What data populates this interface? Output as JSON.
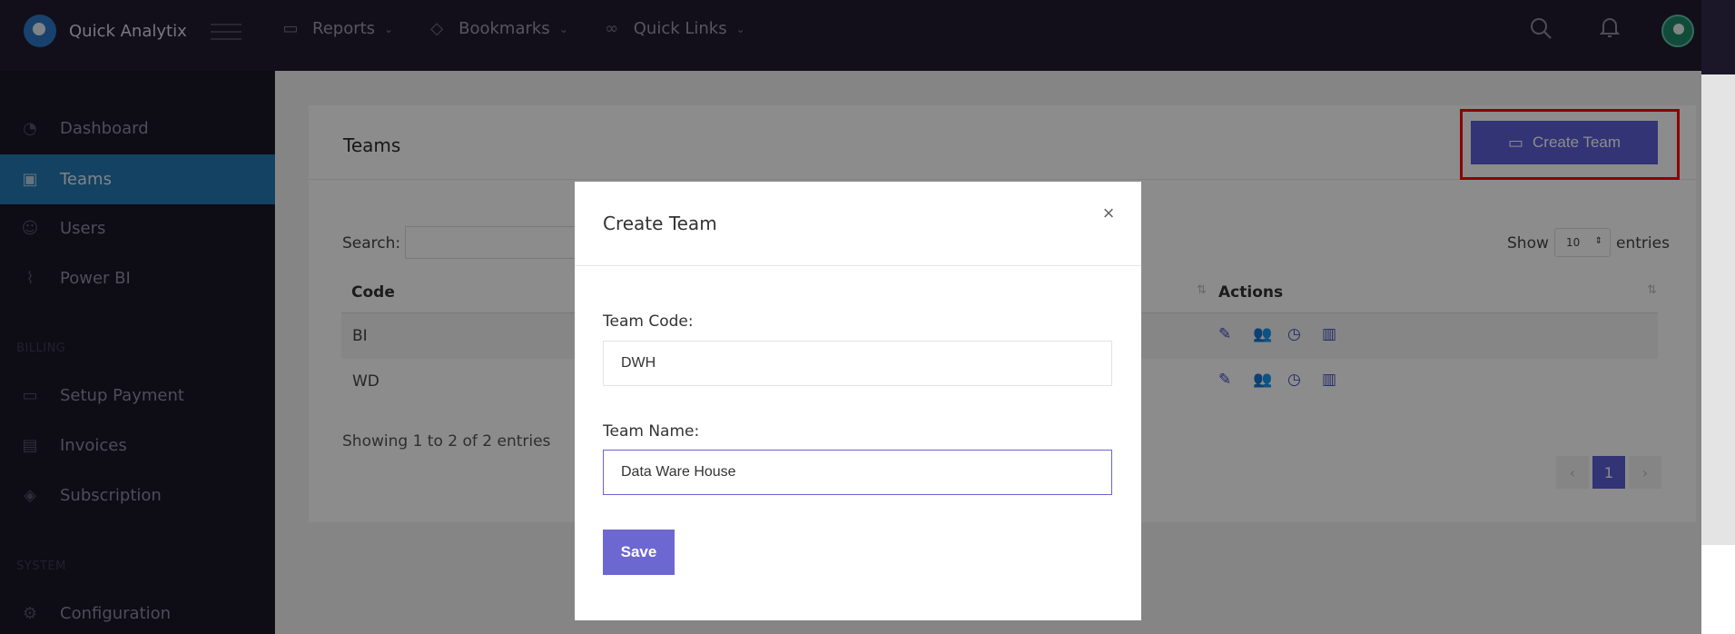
{
  "app": {
    "name": "Quick Analytix"
  },
  "topnav": [
    {
      "label": "Reports",
      "icon": "presentation-icon"
    },
    {
      "label": "Bookmarks",
      "icon": "tag-icon"
    },
    {
      "label": "Quick Links",
      "icon": "link-icon"
    }
  ],
  "sidebar": {
    "items": [
      {
        "label": "Dashboard",
        "icon": "gauge-icon"
      },
      {
        "label": "Teams",
        "icon": "teams-icon",
        "active": true
      },
      {
        "label": "Users",
        "icon": "users-icon"
      },
      {
        "label": "Power BI",
        "icon": "chart-icon"
      },
      {
        "label": "Setup Payment",
        "icon": "card-icon"
      },
      {
        "label": "Invoices",
        "icon": "document-icon"
      },
      {
        "label": "Subscription",
        "icon": "tag-icon"
      },
      {
        "label": "Configuration",
        "icon": "gear-icon"
      }
    ],
    "sections": {
      "billing": "BILLING",
      "system": "SYSTEM"
    }
  },
  "page": {
    "title": "Teams",
    "create_button": "Create Team",
    "search_label": "Search:",
    "show_label": "Show",
    "show_value": "10",
    "entries_label": "entries",
    "columns": {
      "code": "Code",
      "actions": "Actions"
    },
    "rows": [
      {
        "code": "BI"
      },
      {
        "code": "WD"
      }
    ],
    "info": "Showing 1 to 2 of 2 entries",
    "pagination": {
      "prev": "‹",
      "current": "1",
      "next": "›"
    }
  },
  "modal": {
    "title": "Create Team",
    "close": "×",
    "team_code_label": "Team Code:",
    "team_code_value": "DWH",
    "team_name_label": "Team Name:",
    "team_name_value": "Data Ware House",
    "save_label": "Save"
  },
  "colors": {
    "accent": "#5b5fd8",
    "sidebar_active": "#2578b3",
    "highlight": "#ff0000"
  }
}
